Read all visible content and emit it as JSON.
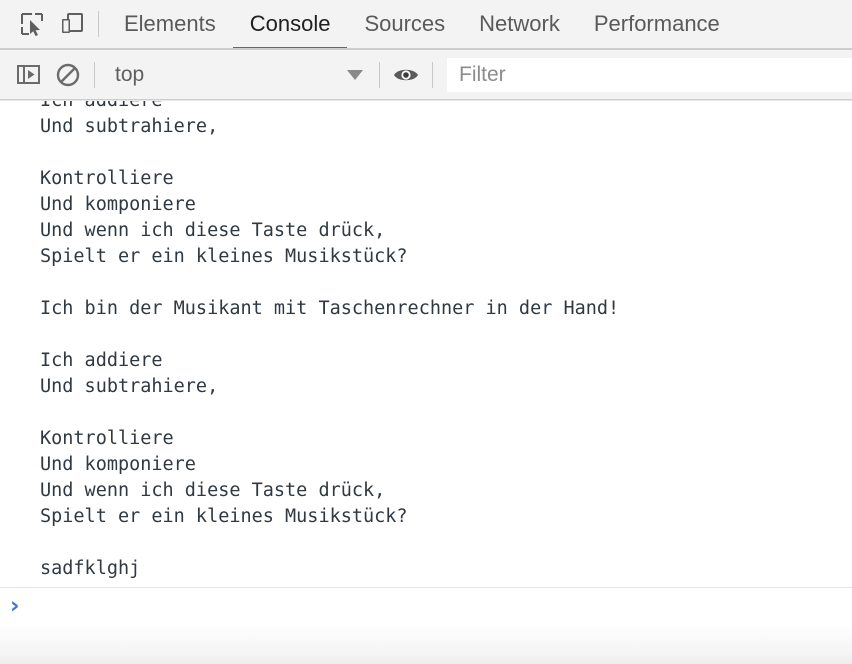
{
  "tabbar": {
    "inspect_icon": "inspect-element-icon",
    "device_icon": "device-toolbar-icon",
    "tabs": [
      {
        "label": "Elements",
        "active": false
      },
      {
        "label": "Console",
        "active": true
      },
      {
        "label": "Sources",
        "active": false
      },
      {
        "label": "Network",
        "active": false
      },
      {
        "label": "Performance",
        "active": false
      }
    ]
  },
  "console_toolbar": {
    "sidebar_icon": "console-sidebar-icon",
    "clear_icon": "clear-console-icon",
    "context": "top",
    "caret_icon": "chevron-down-icon",
    "eye_icon": "live-expression-eye-icon",
    "filter_placeholder": "Filter",
    "filter_value": ""
  },
  "console_output": {
    "lines": [
      "Ich addiere",
      "Und subtrahiere,",
      "",
      "Kontrolliere",
      "Und komponiere",
      "Und wenn ich diese Taste drück,",
      "Spielt er ein kleines Musikstück?",
      "",
      "Ich bin der Musikant mit Taschenrechner in der Hand!",
      "",
      "Ich addiere",
      "Und subtrahiere,",
      "",
      "Kontrolliere",
      "Und komponiere",
      "Und wenn ich diese Taste drück,",
      "Spielt er ein kleines Musikstück?",
      "",
      "sadfklghj"
    ]
  },
  "prompt": {
    "chevron": "›",
    "value": "",
    "chevron_color": "#3b78e7"
  },
  "colors": {
    "accent": "#1a73e8",
    "toolbar_bg": "#f3f3f3",
    "text": "#303942",
    "tab_inactive": "#5a5a5a"
  }
}
